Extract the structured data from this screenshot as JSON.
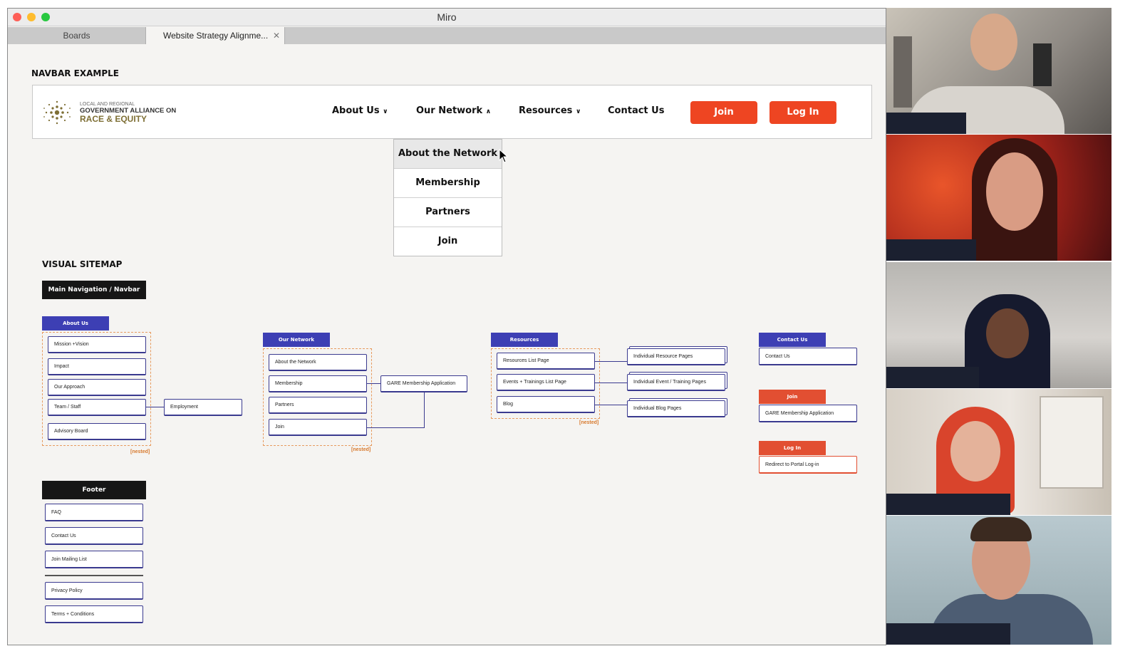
{
  "window": {
    "title": "Miro"
  },
  "tabs": [
    {
      "label": "Boards"
    },
    {
      "label": "Website Strategy Alignme..."
    }
  ],
  "navbar_example": {
    "heading": "NAVBAR EXAMPLE",
    "logo": {
      "line1": "LOCAL AND REGIONAL",
      "line2": "GOVERNMENT ALLIANCE ON",
      "line3": "RACE & EQUITY"
    },
    "links": [
      {
        "label": "About Us",
        "caret": "∨"
      },
      {
        "label": "Our Network",
        "caret": "∧"
      },
      {
        "label": "Resources",
        "caret": "∨"
      },
      {
        "label": "Contact Us"
      }
    ],
    "join_label": "Join",
    "login_label": "Log In",
    "dropdown": [
      "About the Network",
      "Membership",
      "Partners",
      "Join"
    ]
  },
  "sitemap": {
    "heading": "VISUAL SITEMAP",
    "main_nav_label": "Main Navigation / Navbar",
    "about": {
      "header": "About Us",
      "items": [
        "Mission +Vision",
        "Impact",
        "Our Approach",
        "Team / Staff",
        "Advisory Board"
      ],
      "child": "Employment",
      "nested": "[nested]"
    },
    "network": {
      "header": "Our Network",
      "items": [
        "About the Network",
        "Membership",
        "Partners",
        "Join"
      ],
      "child": "GARE Membership Application",
      "nested": "[nested]"
    },
    "resources": {
      "header": "Resources",
      "items": [
        "Resources List Page",
        "Events + Trainings List Page",
        "Blog"
      ],
      "children": [
        "Individual Resource Pages",
        "Individual Event / Training Pages",
        "Individual Blog Pages"
      ],
      "nested": "[nested]"
    },
    "contact": {
      "header": "Contact Us",
      "item": "Contact Us"
    },
    "join": {
      "header": "Join",
      "item": "GARE Membership Application"
    },
    "login": {
      "header": "Log In",
      "item": "Redirect to Portal Log-in"
    },
    "footer": {
      "header": "Footer",
      "items": [
        "FAQ",
        "Contact Us",
        "Join Mailing List"
      ],
      "legal": [
        "Privacy Policy",
        "Terms + Conditions"
      ]
    }
  },
  "colors": {
    "accent_red": "#ee4522",
    "sitemap_blue": "#3d3fb4",
    "sitemap_red": "#e24f32"
  },
  "participants": [
    {
      "name": "participant-1"
    },
    {
      "name": "participant-2"
    },
    {
      "name": "participant-3"
    },
    {
      "name": "participant-4"
    },
    {
      "name": "participant-5"
    }
  ]
}
